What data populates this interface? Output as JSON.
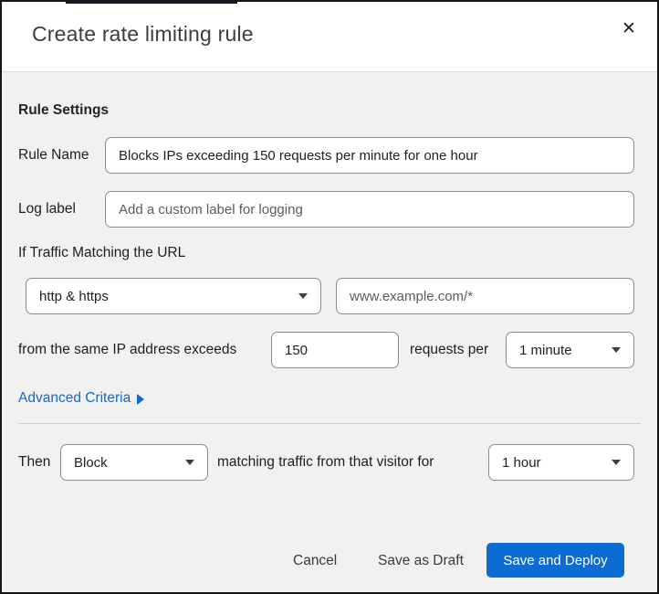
{
  "dialog": {
    "title": "Create rate limiting rule"
  },
  "icons": {
    "close": "✕"
  },
  "form": {
    "section_heading": "Rule Settings",
    "rule_name": {
      "label": "Rule Name",
      "value": "Blocks IPs exceeding 150 requests per minute for one hour"
    },
    "log_label": {
      "label": "Log label",
      "placeholder": "Add a custom label for logging"
    },
    "traffic": {
      "heading": "If Traffic Matching the URL",
      "scheme_selected": "http & https",
      "url_placeholder": "www.example.com/*"
    },
    "threshold": {
      "prefix": "from the same IP address exceeds",
      "requests_value": "150",
      "suffix": "requests per",
      "period_selected": "1 minute"
    },
    "advanced_criteria_label": "Advanced Criteria",
    "action": {
      "prefix": "Then",
      "action_selected": "Block",
      "middle": "matching traffic from that visitor for",
      "duration_selected": "1 hour"
    }
  },
  "footer": {
    "cancel_label": "Cancel",
    "save_draft_label": "Save as Draft",
    "save_deploy_label": "Save and Deploy"
  },
  "colors": {
    "primary_button": "#0d6bd4",
    "link": "#1569c7",
    "body_background": "#f1f1ef",
    "input_border": "#8b8b8b"
  }
}
